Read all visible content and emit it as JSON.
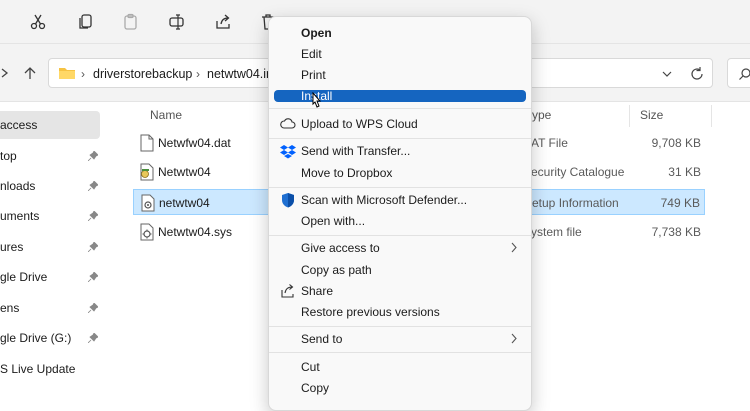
{
  "toolbar": {
    "icons": [
      "cut-icon",
      "copy-icon",
      "paste-icon",
      "rename-icon",
      "share-icon",
      "delete-icon"
    ]
  },
  "address": {
    "crumbs": [
      "driverstorebackup",
      "netwtw04.in"
    ]
  },
  "sidebar": {
    "items": [
      {
        "label": "access",
        "selected": true,
        "pinned": false
      },
      {
        "label": "top",
        "pinned": true
      },
      {
        "label": "nloads",
        "pinned": true
      },
      {
        "label": "uments",
        "pinned": true
      },
      {
        "label": "ures",
        "pinned": true
      },
      {
        "label": "gle Drive",
        "pinned": true
      },
      {
        "label": "ens",
        "pinned": true
      },
      {
        "label": "gle Drive (G:)",
        "pinned": true
      },
      {
        "label": "S Live Update",
        "pinned": false
      }
    ]
  },
  "columns": {
    "name": "Name",
    "type": "ype",
    "size": "Size"
  },
  "files": [
    {
      "name": "Netwfw04.dat",
      "type": "AT File",
      "size": "9,708 KB",
      "icon": "document-icon",
      "selected": false
    },
    {
      "name": "Netwtw04",
      "type": "ecurity Catalogue",
      "size": "31 KB",
      "icon": "catalog-icon",
      "selected": false
    },
    {
      "name": "netwtw04",
      "type": "etup Information",
      "size": "749 KB",
      "icon": "setup-info-icon",
      "selected": true
    },
    {
      "name": "Netwtw04.sys",
      "type": "ystem file",
      "size": "7,738 KB",
      "icon": "system-file-icon",
      "selected": false
    }
  ],
  "context_menu": {
    "items": [
      {
        "label": "Open",
        "bold": true
      },
      {
        "label": "Edit"
      },
      {
        "label": "Print"
      },
      {
        "label": "Install",
        "hover": true
      },
      {
        "label": "Upload to WPS Cloud",
        "icon": "cloud-icon"
      },
      {
        "label": "Send with Transfer...",
        "icon": "dropbox-icon"
      },
      {
        "label": "Move to Dropbox"
      },
      {
        "label": "Scan with Microsoft Defender...",
        "icon": "defender-shield-icon"
      },
      {
        "label": "Open with..."
      },
      {
        "label": "Give access to",
        "submenu": true
      },
      {
        "label": "Copy as path"
      },
      {
        "label": "Share",
        "icon": "share-icon"
      },
      {
        "label": "Restore previous versions"
      },
      {
        "label": "Send to",
        "submenu": true
      },
      {
        "label": "Cut"
      },
      {
        "label": "Copy"
      }
    ]
  },
  "colors": {
    "selection": "#cce8ff",
    "menu_hover": "#1565c0",
    "folder": "#f6c343"
  }
}
